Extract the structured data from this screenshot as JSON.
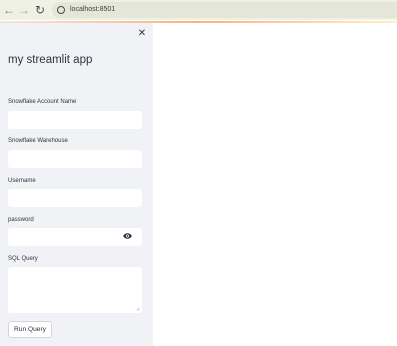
{
  "browser": {
    "url": "localhost:8501",
    "back_icon": "arrow-left-icon",
    "forward_icon": "arrow-right-icon",
    "reload_icon": "reload-icon",
    "info_icon": "info-icon"
  },
  "sidebar": {
    "title": "my streamlit app",
    "close_icon": "close-icon",
    "fields": {
      "account": {
        "label": "Snowflake Account Name",
        "value": ""
      },
      "warehouse": {
        "label": "Snowflake Warehouse",
        "value": ""
      },
      "username": {
        "label": "Username",
        "value": ""
      },
      "password": {
        "label": "password",
        "value": "",
        "toggle_icon": "eye-icon"
      },
      "sql": {
        "label": "SQL Query",
        "value": ""
      }
    },
    "run_button": "Run Query"
  },
  "colors": {
    "sidebar_bg": "#f0f2f6",
    "browser_bar_bg": "#eff1e4",
    "text": "#31333f",
    "input_bg": "#ffffff"
  }
}
